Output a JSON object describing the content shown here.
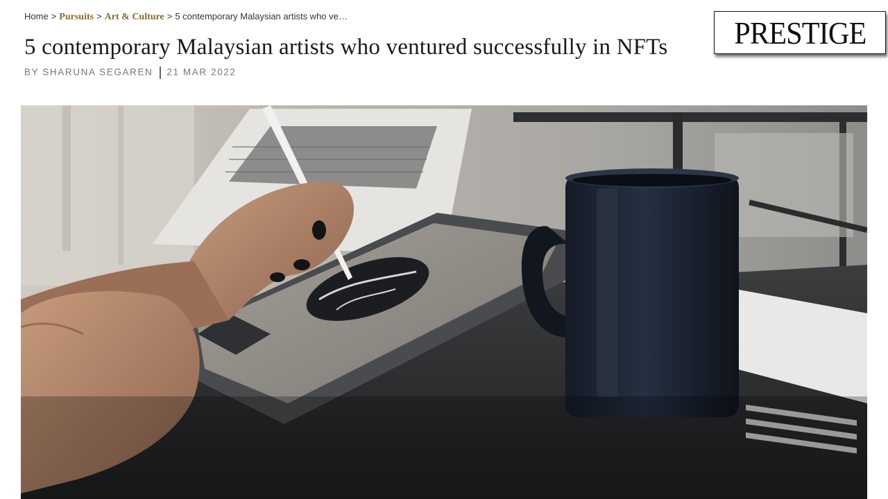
{
  "breadcrumb": {
    "home": "Home",
    "separator": ">",
    "pursuits": "Pursuits",
    "art_culture": "Art & Culture",
    "current": "5 contemporary Malaysian artists who ve…"
  },
  "article": {
    "title": "5 contemporary Malaysian artists who ventured successfully in NFTs",
    "byline_author": "BY SHARUNA SEGAREN",
    "byline_date": "21 MAR 2022"
  },
  "logo": {
    "text": "PRESTIGE"
  },
  "hero_image": {
    "alt": "hero-photo-tablet-drawing"
  },
  "colors": {
    "accent": "#8a6a2e",
    "title_text": "#1a1a1a",
    "byline_text": "#777777"
  }
}
